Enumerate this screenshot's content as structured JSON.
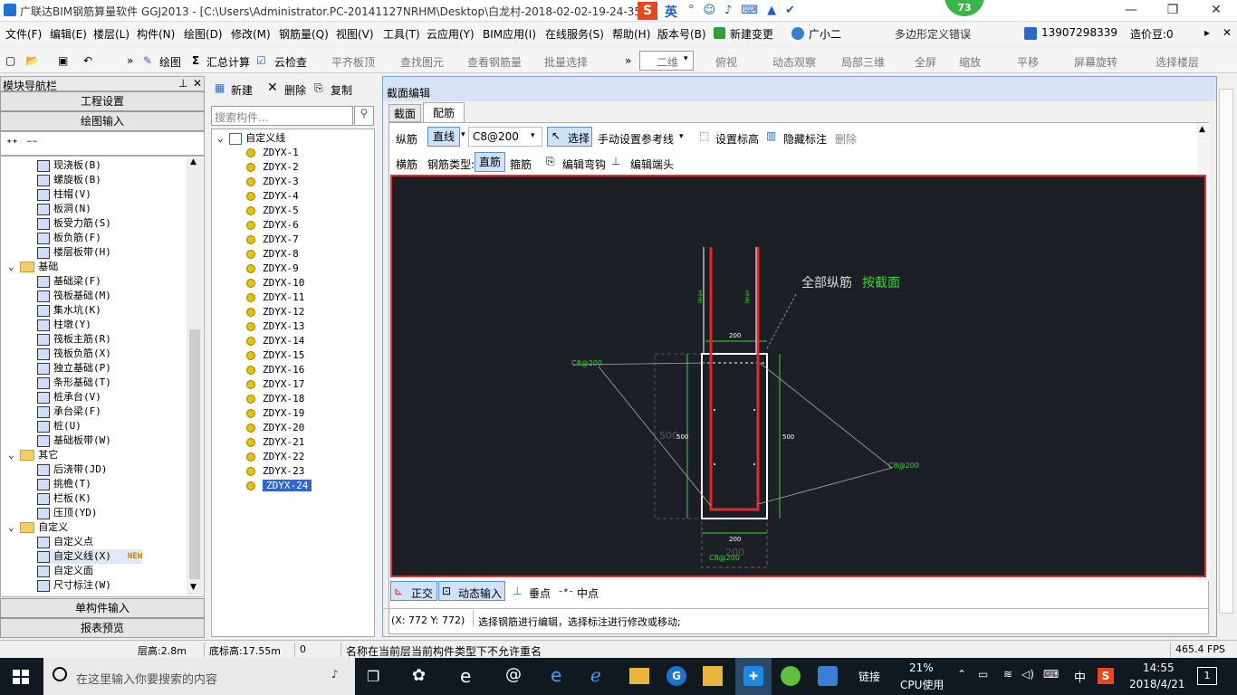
{
  "window": {
    "title": "广联达BIM钢筋算量软件 GGJ2013 - [C:\\Users\\Administrator.PC-20141127NRHM\\Desktop\\白龙村-2018-02-02-19-24-35",
    "badge": "73",
    "ime_label": "英"
  },
  "menu": {
    "items": [
      "文件(F)",
      "编辑(E)",
      "楼层(L)",
      "构件(N)",
      "绘图(D)",
      "修改(M)",
      "钢筋量(Q)",
      "视图(V)",
      "工具(T)",
      "云应用(Y)",
      "BIM应用(I)",
      "在线服务(S)",
      "帮助(H)",
      "版本号(B)",
      "新建变更",
      "广小二",
      "多边形定义错误",
      "13907298339",
      "造价豆:0"
    ]
  },
  "toolbar": {
    "items": [
      "绘图",
      "汇总计算",
      "云检查",
      "平齐板顶",
      "查找图元",
      "查看钢筋量",
      "批量选择",
      "二维",
      "俯视",
      "动态观察",
      "局部三维",
      "全屏",
      "缩放",
      "平移",
      "屏幕旋转",
      "选择楼层"
    ]
  },
  "nav": {
    "title": "模块导航栏",
    "project_settings": "工程设置",
    "drawing_input": "绘图输入",
    "single_input": "单构件输入",
    "report_preview": "报表预览",
    "tree": [
      {
        "label": "现浇板(B)",
        "level": 2
      },
      {
        "label": "螺旋板(B)",
        "level": 2
      },
      {
        "label": "柱帽(V)",
        "level": 2
      },
      {
        "label": "板洞(N)",
        "level": 2
      },
      {
        "label": "板受力筋(S)",
        "level": 2
      },
      {
        "label": "板负筋(F)",
        "level": 2
      },
      {
        "label": "楼层板带(H)",
        "level": 2
      },
      {
        "label": "基础",
        "level": 1
      },
      {
        "label": "基础梁(F)",
        "level": 2
      },
      {
        "label": "筏板基础(M)",
        "level": 2
      },
      {
        "label": "集水坑(K)",
        "level": 2
      },
      {
        "label": "柱墩(Y)",
        "level": 2
      },
      {
        "label": "筏板主筋(R)",
        "level": 2
      },
      {
        "label": "筏板负筋(X)",
        "level": 2
      },
      {
        "label": "独立基础(P)",
        "level": 2
      },
      {
        "label": "条形基础(T)",
        "level": 2
      },
      {
        "label": "桩承台(V)",
        "level": 2
      },
      {
        "label": "承台梁(F)",
        "level": 2
      },
      {
        "label": "桩(U)",
        "level": 2
      },
      {
        "label": "基础板带(W)",
        "level": 2
      },
      {
        "label": "其它",
        "level": 1
      },
      {
        "label": "后浇带(JD)",
        "level": 2
      },
      {
        "label": "挑檐(T)",
        "level": 2
      },
      {
        "label": "栏板(K)",
        "level": 2
      },
      {
        "label": "压顶(YD)",
        "level": 2
      },
      {
        "label": "自定义",
        "level": 1
      },
      {
        "label": "自定义点",
        "level": 2
      },
      {
        "label": "自定义线(X)",
        "level": 2
      },
      {
        "label": "自定义面",
        "level": 2
      },
      {
        "label": "尺寸标注(W)",
        "level": 2
      }
    ],
    "new_badge": "NEW"
  },
  "components": {
    "new_label": "新建",
    "delete_label": "删除",
    "copy_label": "复制",
    "search_placeholder": "搜索构件...",
    "root": "自定义线",
    "items": [
      "ZDYX-1",
      "ZDYX-2",
      "ZDYX-3",
      "ZDYX-4",
      "ZDYX-5",
      "ZDYX-6",
      "ZDYX-7",
      "ZDYX-8",
      "ZDYX-9",
      "ZDYX-10",
      "ZDYX-11",
      "ZDYX-12",
      "ZDYX-13",
      "ZDYX-14",
      "ZDYX-15",
      "ZDYX-16",
      "ZDYX-17",
      "ZDYX-18",
      "ZDYX-19",
      "ZDYX-20",
      "ZDYX-21",
      "ZDYX-22",
      "ZDYX-23",
      "ZDYX-24"
    ],
    "selected": "ZDYX-24"
  },
  "editor": {
    "title": "截面编辑",
    "tabs": [
      "截面",
      "配筋"
    ],
    "row1": {
      "zongjin": "纵筋",
      "line": "直线",
      "spec": "C8@200",
      "select": "选择",
      "manual": "手动设置参考线",
      "set_elev": "设置标高",
      "hide_mark": "隐藏标注",
      "delete": "删除"
    },
    "row2": {
      "hengjin": "横筋",
      "type_label": "钢筋类型:",
      "straight": "直筋",
      "stirrup": "箍筋",
      "edit_hook": "编辑弯钩",
      "edit_end": "编辑端头"
    },
    "bottom": {
      "ortho": "正交",
      "dynamic": "动态输入",
      "perp": "垂点",
      "mid": "中点"
    },
    "coords": "(X: 772 Y: 772)",
    "hint": "选择钢筋进行编辑，选择标注进行修改或移动;"
  },
  "canvas": {
    "note_prefix": "全部纵筋",
    "note_link": "按截面",
    "labels": {
      "c8_left": "C8@200",
      "c8_right": "C8@200",
      "c8_bottom": "C8@200",
      "dim200_top": "200",
      "dim200_bot": "200",
      "dim500_l": "500",
      "dim500_r": "500",
      "dim300": "300",
      "ghost500": "500",
      "ghost200": "200"
    }
  },
  "status": {
    "floor_h": "层高:2.8m",
    "base_elev": "底标高:17.55m",
    "zero": "0",
    "msg": "名称在当前层当前构件类型下不允许重名",
    "fps": "465.4 FPS"
  },
  "taskbar": {
    "search": "在这里输入你要搜索的内容",
    "link": "链接",
    "cpu": "21%",
    "cpu_label": "CPU使用",
    "lang": "中",
    "time": "14:55",
    "date": "2018/4/21",
    "notif": "1"
  }
}
